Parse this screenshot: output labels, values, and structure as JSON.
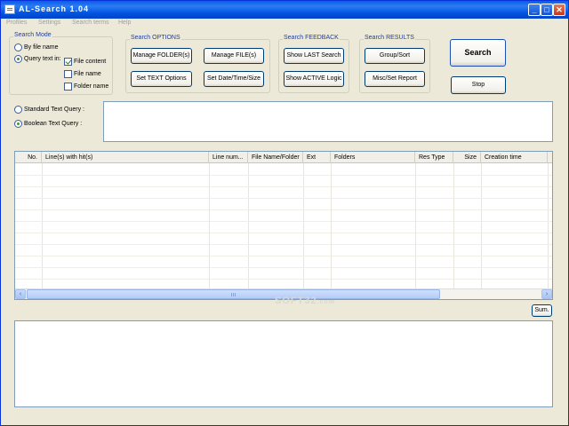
{
  "window": {
    "title": "AL-Search  1.04"
  },
  "titlebar_buttons": {
    "minimize": "_",
    "maximize": "□",
    "close": "✕"
  },
  "menu": [
    "Profiles",
    "Settings",
    "Search terms",
    "Help"
  ],
  "search_mode": {
    "title": "Search Mode",
    "by_file_name": "By file name",
    "query_text_in": "Query text in:",
    "file_content": "File content",
    "file_name": "File name",
    "folder_name": "Folder name"
  },
  "search_options": {
    "title": "Search OPTIONS",
    "manage_folders": "Manage FOLDER(s)",
    "manage_files": "Manage FILE(s)",
    "set_text_options": "Set TEXT Options",
    "set_date_time_size": "Set Date/Time/Size"
  },
  "search_feedback": {
    "title": "Search FEEDBACK",
    "show_last_search": "Show LAST Search",
    "show_active_logic": "Show ACTIVE Logic"
  },
  "search_results": {
    "title": "Search RESULTS",
    "group_sort": "Group/Sort",
    "misc_set_report": "Misc/Set Report"
  },
  "actions": {
    "search": "Search",
    "stop": "Stop"
  },
  "query": {
    "standard": "Standard Text Query :",
    "boolean": "Boolean Text Query :",
    "value": ""
  },
  "results_table": {
    "columns": [
      "No.",
      "Line(s) with hit(s)",
      "Line num...",
      "File Name/Folder",
      "Ext",
      "Folders",
      "Res Type",
      "Size",
      "Creation time"
    ]
  },
  "scrollbar": {
    "left": "‹",
    "right": "›"
  },
  "sum_button": "Sum.",
  "watermark": {
    "main": "SOFT32",
    "suffix": ".com"
  },
  "report": {
    "value": ""
  },
  "colors": {
    "titlebar": "#0a5ce8",
    "group_title": "#1f3ea8",
    "window_bg": "#ece9d8"
  }
}
